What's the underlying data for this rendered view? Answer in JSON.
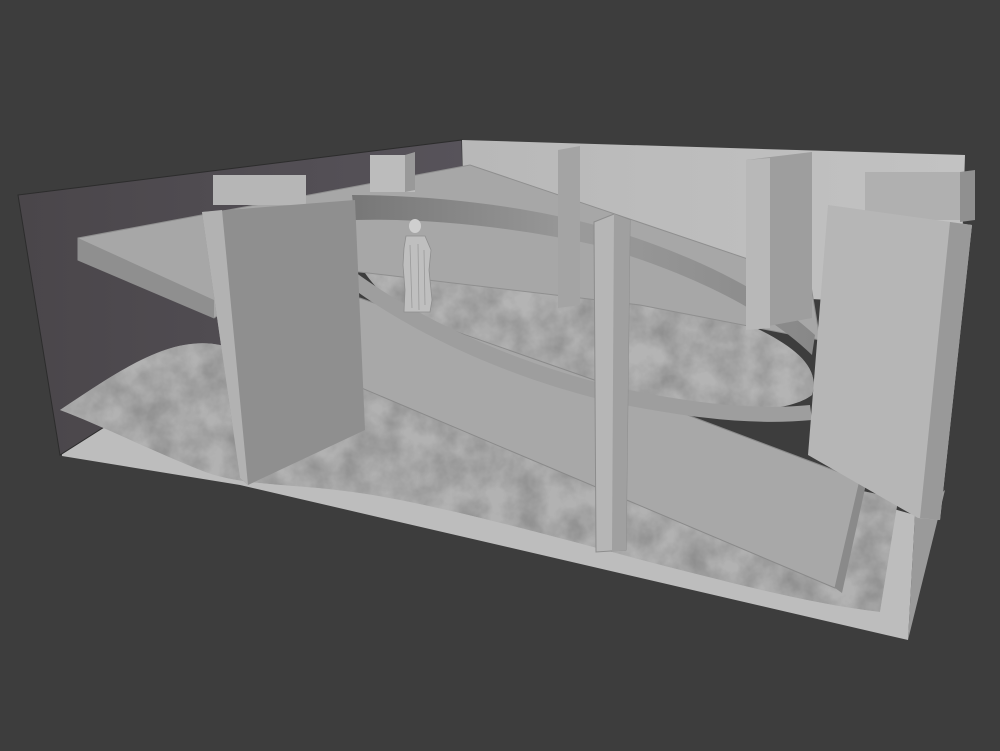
{
  "viewport": {
    "mode": "3d-solid-shading",
    "background_color": "#3d3d3d"
  },
  "scene": {
    "objects": [
      "ground-plane",
      "terrain-lower",
      "terrain-upper",
      "back-wall",
      "left-wall",
      "curved-bridge",
      "lower-walkway",
      "upper-walkway",
      "statue",
      "pillars"
    ]
  },
  "colors": {
    "wall": "#b4b4b4",
    "wall_dark": "#8e8e8e",
    "slab": "#a8a8a8",
    "terrain": "#b0b0b0",
    "floor": "#c4c4c4",
    "shadow": "#4e4b4e"
  }
}
